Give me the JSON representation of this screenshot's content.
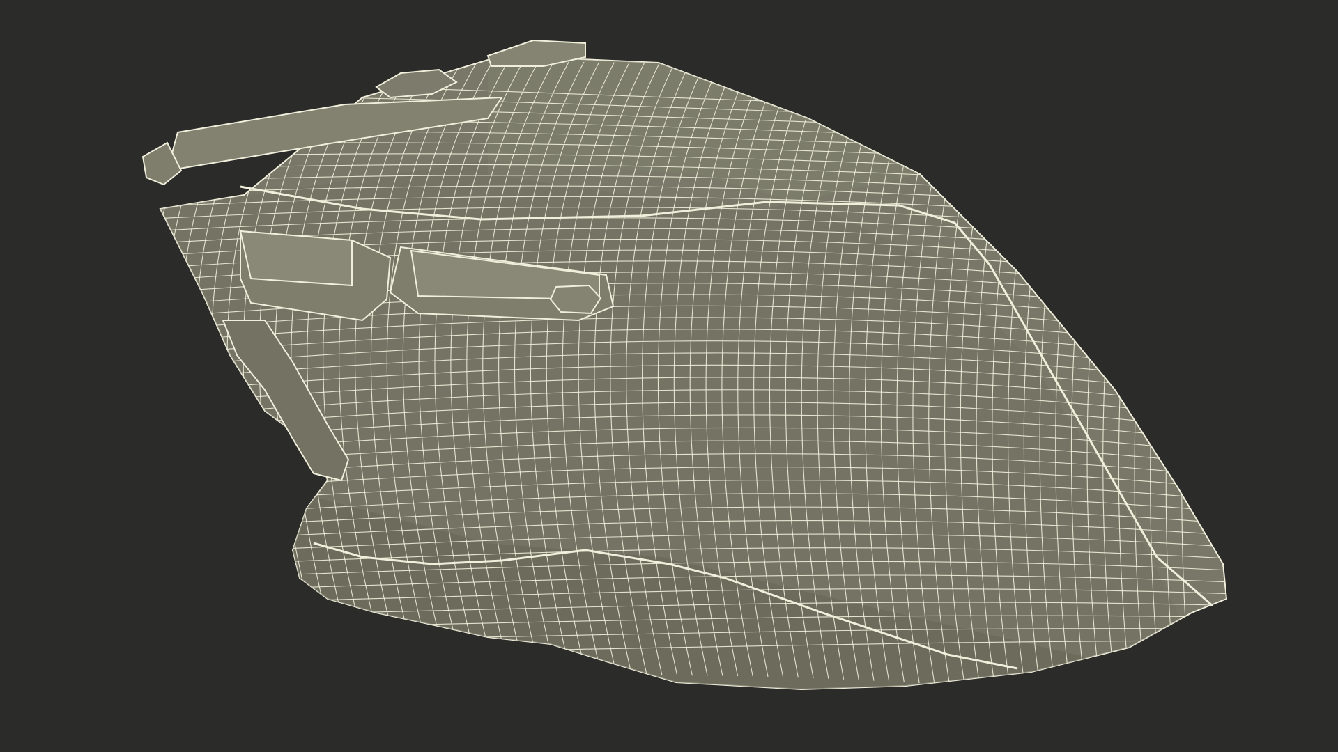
{
  "scene": {
    "subject": "computer-mouse-wireframe",
    "background_color": "#2b2b2a",
    "surface_color": "#797868",
    "surface_shade_color": "#6b6a5b",
    "surface_light_color": "#858472",
    "wire_color": "#f1efdc"
  }
}
